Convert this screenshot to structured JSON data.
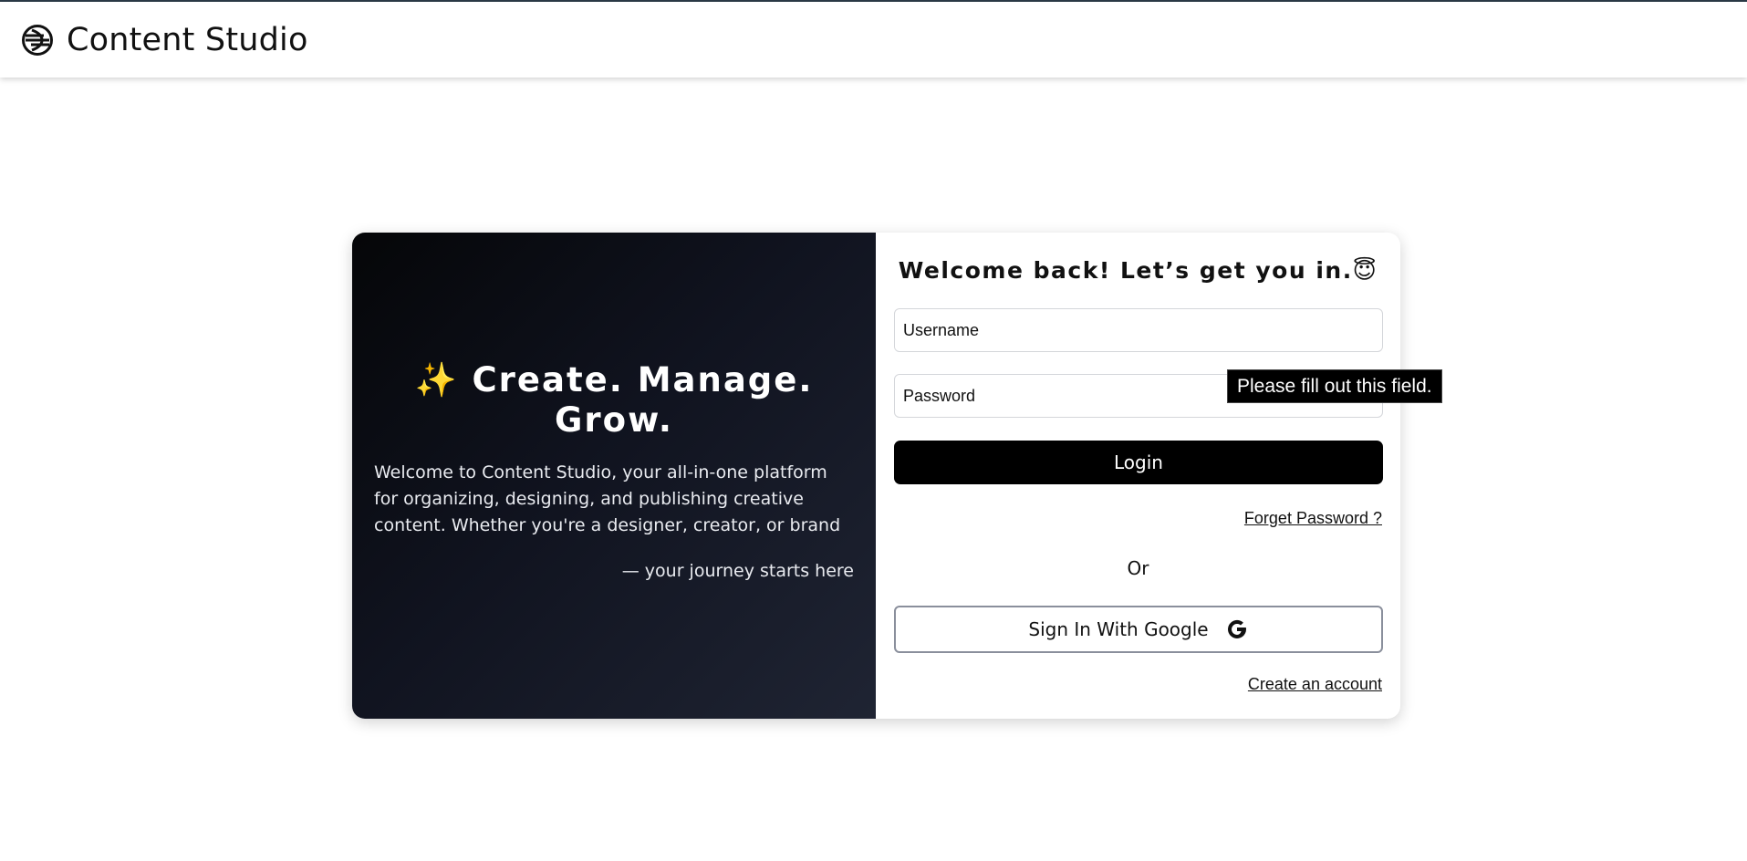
{
  "app": {
    "brand": "Content Studio",
    "logo_icon": "globe-logo-icon"
  },
  "hero": {
    "sparkle": "✨",
    "title": "Create. Manage. Grow.",
    "description": "Welcome to Content Studio, your all-in-one platform for organizing, designing, and publishing creative content. Whether you're a designer, creator, or brand",
    "tagline": "— your journey starts here"
  },
  "login": {
    "welcome": "Welcome back! Let’s get you in.😇",
    "username_placeholder": "Username",
    "password_placeholder": "Password",
    "login_label": "Login",
    "forget_label": "Forget Password ?",
    "or_label": "Or",
    "google_label": "Sign In With Google",
    "google_icon": "google-icon",
    "create_label": "Create an account"
  },
  "tooltip": {
    "text": "Please fill out this field."
  },
  "colors": {
    "hero_gradient_start": "#050608",
    "hero_gradient_end": "#1f2433",
    "login_button": "#000000",
    "sparkle": "#f5c518"
  }
}
